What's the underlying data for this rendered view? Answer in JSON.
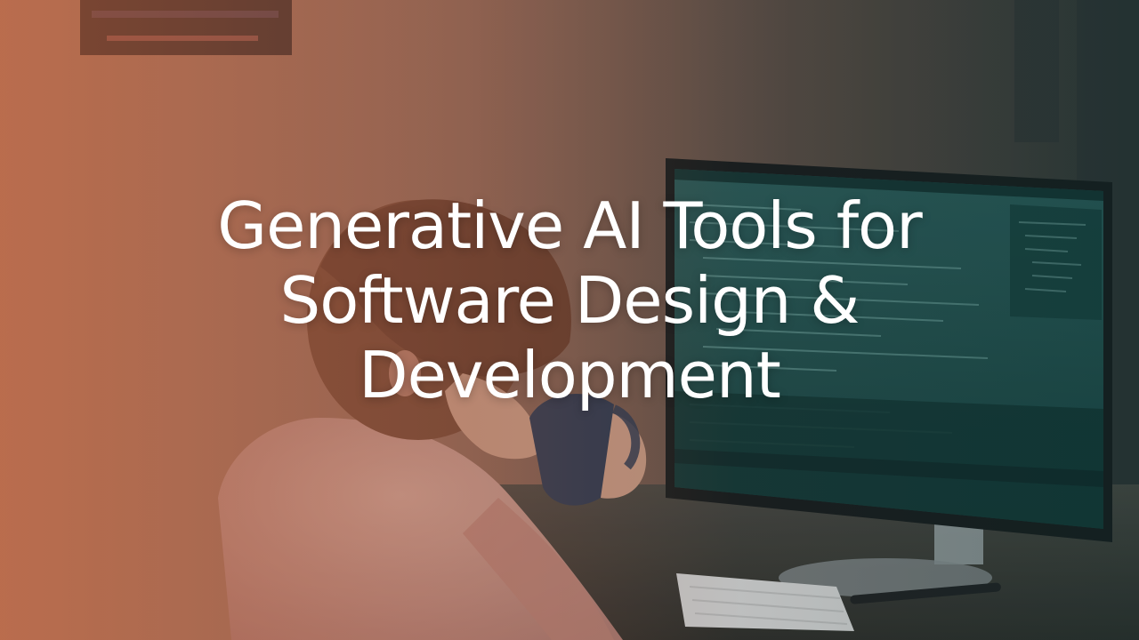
{
  "hero": {
    "title": "Generative AI Tools for Software Design & Development"
  },
  "scene": {
    "subject": "person drinking from a mug at a desk in front of a monitor showing code",
    "colors": {
      "warm_wall": "#b7795d",
      "dark_wall": "#4a4038",
      "monitor_screen": "#1f5552",
      "monitor_frame": "#1a1d1f",
      "shirt": "#d7a899",
      "hair": "#6b3f2b",
      "skin": "#d9a88f",
      "mug": "#2a3a55",
      "keyboard": "#e7e7e7",
      "desk": "#3a3a36"
    }
  }
}
